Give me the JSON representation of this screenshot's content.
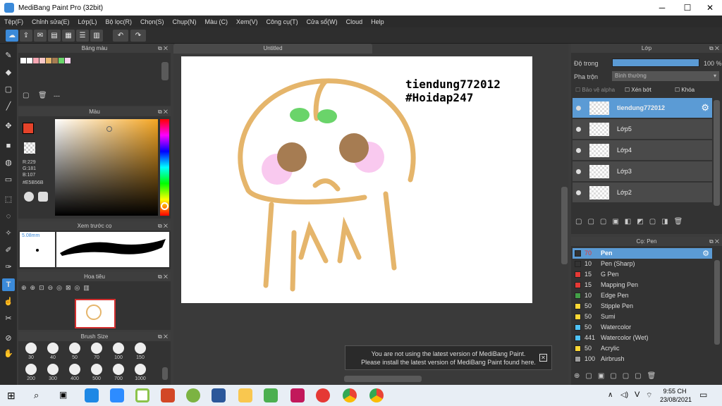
{
  "window": {
    "title": "MediBang Paint Pro (32bit)"
  },
  "menu": [
    "Tệp(F)",
    "Chỉnh sửa(E)",
    "Lớp(L)",
    "Bộ lọc(R)",
    "Chọn(S)",
    "Chụp(N)",
    "Màu (C)",
    "Xem(V)",
    "Công cụ(T)",
    "Cửa sổ(W)",
    "Cloud",
    "Help"
  ],
  "panels": {
    "palette": "Bảng màu",
    "palette_dashes": "---",
    "color": "Màu",
    "preview": "Xem trước cọ",
    "navigator": "Hoa tiêu",
    "brush_size": "Brush Size",
    "layer": "Lớp",
    "brush": "Cọ: Pen"
  },
  "color": {
    "r": "R:229",
    "g": "G:181",
    "b": "B:107",
    "hex": "#E5B56B",
    "fg": "#E5432A"
  },
  "brush_preview": {
    "size": "5.08mm"
  },
  "brush_sizes": [
    "30",
    "40",
    "50",
    "70",
    "100",
    "150",
    "200",
    "300",
    "400",
    "500",
    "700",
    "1000"
  ],
  "document": {
    "tab": "Untitled",
    "text1": "tiendung772012",
    "text2": "#Hoidap247"
  },
  "layer_props": {
    "opacity_label": "Độ trong",
    "opacity": "100 %",
    "opacity_value": 1.0,
    "blend_label": "Pha trộn",
    "blend": "Bình thường",
    "alpha": "Bảo vệ alpha",
    "clip": "Xén bớt",
    "lock": "Khóa"
  },
  "layers": [
    {
      "name": "tiendung772012",
      "selected": true
    },
    {
      "name": "Lớp5"
    },
    {
      "name": "Lớp4"
    },
    {
      "name": "Lớp3"
    },
    {
      "name": "Lớp2"
    }
  ],
  "brushes": [
    {
      "size": "70",
      "name": "Pen",
      "color": "#333333",
      "selected": true
    },
    {
      "size": "10",
      "name": "Pen (Sharp)",
      "color": "#333333"
    },
    {
      "size": "15",
      "name": "G Pen",
      "color": "#e53935"
    },
    {
      "size": "15",
      "name": "Mapping Pen",
      "color": "#e53935"
    },
    {
      "size": "10",
      "name": "Edge Pen",
      "color": "#43a047"
    },
    {
      "size": "50",
      "name": "Stipple Pen",
      "color": "#fdd835"
    },
    {
      "size": "50",
      "name": "Sumi",
      "color": "#fdd835"
    },
    {
      "size": "50",
      "name": "Watercolor",
      "color": "#4fc3f7"
    },
    {
      "size": "441",
      "name": "Watercolor (Wet)",
      "color": "#4fc3f7"
    },
    {
      "size": "50",
      "name": "Acrylic",
      "color": "#fdd835"
    },
    {
      "size": "100",
      "name": "Airbrush",
      "color": "#9e9e9e"
    }
  ],
  "notice": {
    "line1": "You are not using the latest version of MediBang Paint.",
    "line2": "Please install the latest version of MediBang Paint found here."
  },
  "taskbar": {
    "time": "9:55 CH",
    "date": "23/08/2021",
    "lang": "V"
  }
}
